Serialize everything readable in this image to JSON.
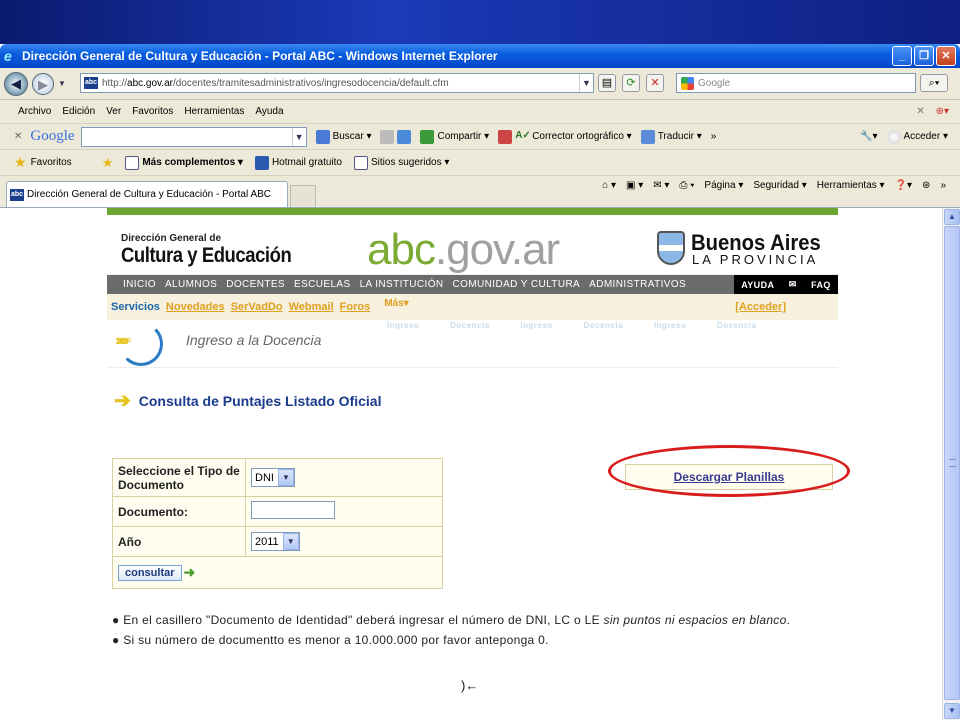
{
  "window": {
    "title": "Dirección General de Cultura y Educación - Portal ABC - Windows Internet Explorer",
    "controls": [
      "_",
      "❐",
      "✕"
    ]
  },
  "address": {
    "favicon": "abc",
    "url_prefix": "http://",
    "url_host": "abc.gov.ar",
    "url_path": "/docentes/tramitesadministrativos/ingresodocencia/default.cfm",
    "search_placeholder": "Google"
  },
  "menu": [
    "Archivo",
    "Edición",
    "Ver",
    "Favoritos",
    "Herramientas",
    "Ayuda"
  ],
  "google_toolbar": {
    "logo": "Google",
    "items": [
      "Buscar ▾",
      "Compartir ▾",
      "Corrector ortográfico ▾",
      "Traducir ▾",
      "»"
    ],
    "acceder": "Acceder ▾"
  },
  "favorites": {
    "label": "Favoritos",
    "items": [
      "Más complementos ▾",
      "Hotmail gratuito",
      "Sitios sugeridos ▾"
    ]
  },
  "tab": {
    "title": "Dirección General de Cultura y Educación - Portal ABC"
  },
  "commandbar": [
    "Página ▾",
    "Seguridad ▾",
    "Herramientas ▾",
    "»"
  ],
  "site": {
    "dgce_small": "Dirección General de",
    "dgce_big": "Cultura y Educación",
    "logo_main": "abc",
    "logo_suffix": ".gov.ar",
    "ba_title": "Buenos Aires",
    "ba_sub": "LA PROVINCIA",
    "nav": [
      "INICIO",
      "ALUMNOS",
      "DOCENTES",
      "ESCUELAS",
      "LA INSTITUCIÓN",
      "COMUNIDAD Y CULTURA",
      "ADMINISTRATIVOS"
    ],
    "nav_right": [
      "AYUDA",
      "✉",
      "FAQ"
    ],
    "services_label": "Servicios",
    "services": [
      "Novedades",
      "SerVadDo",
      "Webmail",
      "Foros",
      "Más▾"
    ],
    "acceder": "[Acceder]",
    "banner_words": "Ingreso Docencia Ingreso Docencia Ingreso Docencia",
    "banner_title": "Ingreso a la Docencia",
    "heading": "Consulta de Puntajes Listado Oficial",
    "form": {
      "tipo_label": "Seleccione el Tipo de Documento",
      "tipo_value": "DNI",
      "documento_label": "Documento:",
      "documento_value": "",
      "anio_label": "Año",
      "anio_value": "2011",
      "button": "consultar"
    },
    "download": "Descargar Planillas",
    "note1_a": "En el casillero \"Documento de Identidad\" deberá ingresar el número de DNI, LC o LE ",
    "note1_b": "sin puntos ni espacios en blanco",
    "note1_c": ".",
    "note2": "Si su número de documentto es menor a 10.000.000 por favor anteponga 0."
  },
  "colors": {
    "accent_green": "#6ba52f",
    "highlight_red": "#d81c1c",
    "link_blue": "#1a3a8c"
  }
}
